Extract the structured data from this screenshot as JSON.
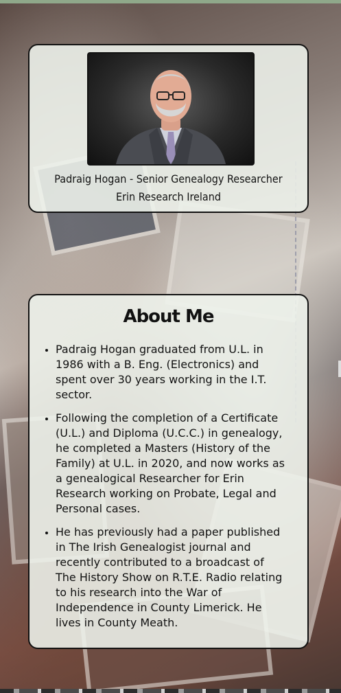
{
  "profile": {
    "photo_alt": "Padraig Hogan",
    "name": "Padraig Hogan - Senior Genealogy Researcher",
    "organization": "Erin Research Ireland"
  },
  "about": {
    "title": "About Me",
    "items": [
      "Padraig Hogan graduated from U.L. in 1986 with a B. Eng. (Electronics) and spent over 30 years working in the I.T. sector.",
      "Following the completion of a Certificate (U.L.) and Diploma (U.C.C.) in genealogy, he completed a Masters (History of the Family) at U.L. in 2020, and now works as a genealogical Researcher for Erin Research working on Probate, Legal and Personal cases.",
      "He has previously had a paper published in The Irish Genealogist journal and recently contributed to a broadcast of The History Show on R.T.E. Radio relating to his research into the War of Independence in County Limerick. He lives in County Meath."
    ]
  },
  "colors": {
    "card_background": "#eef3ec",
    "card_border": "#111111",
    "top_strip": "#8fa88a"
  }
}
